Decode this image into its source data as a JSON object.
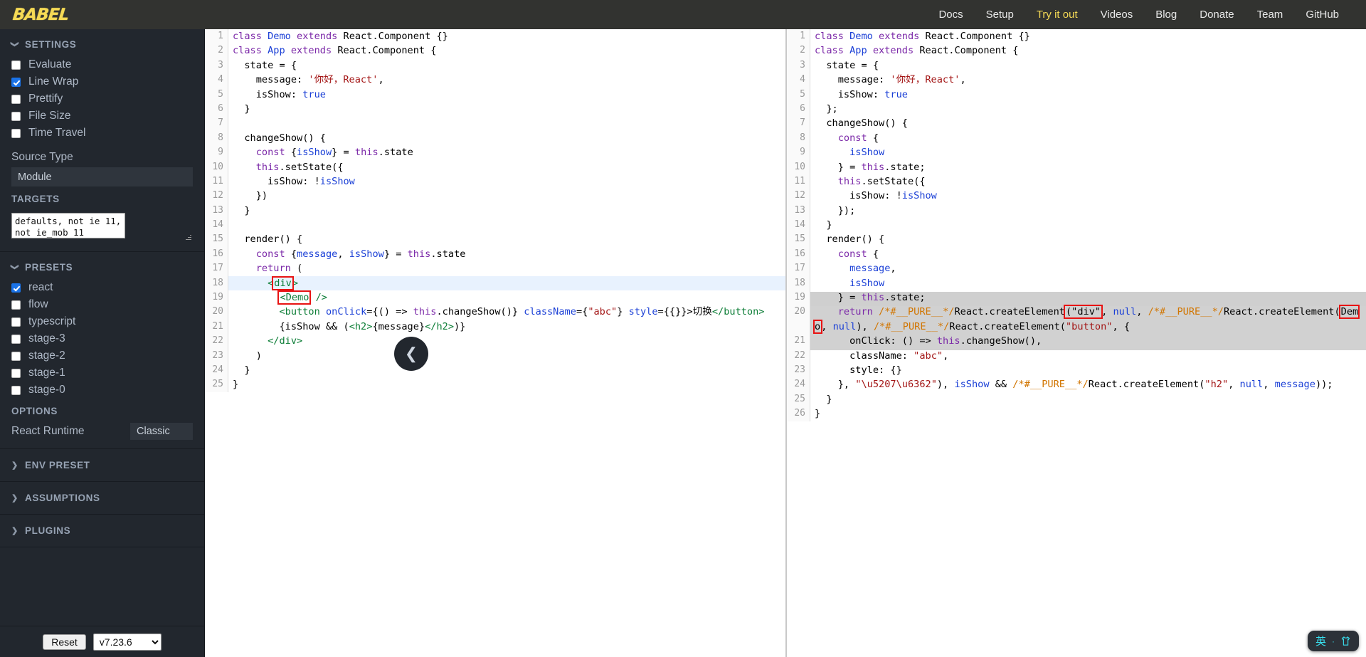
{
  "navbar": {
    "brand": "BABEL",
    "links": [
      {
        "label": "Docs",
        "active": false
      },
      {
        "label": "Setup",
        "active": false
      },
      {
        "label": "Try it out",
        "active": true
      },
      {
        "label": "Videos",
        "active": false
      },
      {
        "label": "Blog",
        "active": false
      },
      {
        "label": "Donate",
        "active": false
      },
      {
        "label": "Team",
        "active": false
      },
      {
        "label": "GitHub",
        "active": false
      }
    ],
    "accent_color": "#f5da55",
    "background": "#323330"
  },
  "sidebar": {
    "settings": {
      "title": "SETTINGS",
      "expanded": true,
      "items": [
        {
          "label": "Evaluate",
          "checked": false
        },
        {
          "label": "Line Wrap",
          "checked": true
        },
        {
          "label": "Prettify",
          "checked": false
        },
        {
          "label": "File Size",
          "checked": false
        },
        {
          "label": "Time Travel",
          "checked": false
        }
      ],
      "source_type_label": "Source Type",
      "source_type_value": "Module"
    },
    "targets": {
      "title": "TARGETS",
      "value": "defaults, not ie 11, not ie_mob 11"
    },
    "presets": {
      "title": "PRESETS",
      "expanded": true,
      "items": [
        {
          "label": "react",
          "checked": true
        },
        {
          "label": "flow",
          "checked": false
        },
        {
          "label": "typescript",
          "checked": false
        },
        {
          "label": "stage-3",
          "checked": false
        },
        {
          "label": "stage-2",
          "checked": false
        },
        {
          "label": "stage-1",
          "checked": false
        },
        {
          "label": "stage-0",
          "checked": false
        }
      ]
    },
    "options": {
      "title": "OPTIONS",
      "react_runtime_label": "React Runtime",
      "react_runtime_value": "Classic"
    },
    "collapsed_sections": [
      {
        "label": "ENV PRESET"
      },
      {
        "label": "ASSUMPTIONS"
      },
      {
        "label": "PLUGINS"
      }
    ],
    "footer": {
      "reset_label": "Reset",
      "version": "v7.23.6"
    }
  },
  "input_editor": {
    "active_line": 18,
    "line_numbers": [
      1,
      2,
      3,
      4,
      5,
      6,
      7,
      8,
      9,
      10,
      11,
      12,
      13,
      14,
      15,
      16,
      17,
      18,
      19,
      20,
      21,
      22,
      23,
      24,
      25
    ],
    "lines": [
      "class Demo extends React.Component {}",
      "class App extends React.Component {",
      "  state = {",
      "    message: '你好，React',",
      "    isShow: true",
      "  }",
      "",
      "  changeShow() {",
      "    const {isShow} = this.state",
      "    this.setState({",
      "      isShow: !isShow",
      "    })",
      "  }",
      "",
      "  render() {",
      "    const {message, isShow} = this.state",
      "    return (",
      "      <div>",
      "        <Demo />",
      "        <button onClick={() => this.changeShow()} className={\"abc\"} style={{}}>切换</button>",
      "        {isShow && (<h2>{message}</h2>)}",
      "      </div>",
      "    )",
      "  }",
      "}"
    ],
    "annotations": [
      {
        "line": 18,
        "text": "div"
      },
      {
        "line": 19,
        "text": "<Demo"
      }
    ]
  },
  "output_editor": {
    "line_numbers": [
      1,
      2,
      3,
      4,
      5,
      6,
      7,
      8,
      9,
      10,
      11,
      12,
      13,
      14,
      15,
      16,
      17,
      18,
      19,
      20,
      21,
      22,
      23,
      24,
      25,
      26
    ],
    "lines": [
      "class Demo extends React.Component {}",
      "class App extends React.Component {",
      "  state = {",
      "    message: '你好，React',",
      "    isShow: true",
      "  };",
      "  changeShow() {",
      "    const {",
      "      isShow",
      "    } = this.state;",
      "    this.setState({",
      "      isShow: !isShow",
      "    });",
      "  }",
      "  render() {",
      "    const {",
      "      message,",
      "      isShow",
      "    } = this.state;",
      "    return /*#__PURE__*/React.createElement(\"div\", null, /*#__PURE__*/React.createElement(Demo, null), /*#__PURE__*/React.createElement(\"button\", {",
      "      onClick: () => this.changeShow(),",
      "      className: \"abc\",",
      "      style: {}",
      "    }, \"\\u5207\\u6362\"), isShow && /*#__PURE__*/React.createElement(\"h2\", null, message));",
      "  }",
      "}"
    ],
    "annotations": [
      {
        "line": 20,
        "text": "(\"div\""
      },
      {
        "line": 20,
        "text": "Demo"
      }
    ],
    "selection_note": "gray selection from line 20 wrap through line 24"
  },
  "collapse_handle": {
    "icon": "chevron-left-icon"
  },
  "ime_badge": {
    "mode": "英",
    "separator": "·",
    "icon": "shirt-icon",
    "color": "#39e0f0"
  }
}
